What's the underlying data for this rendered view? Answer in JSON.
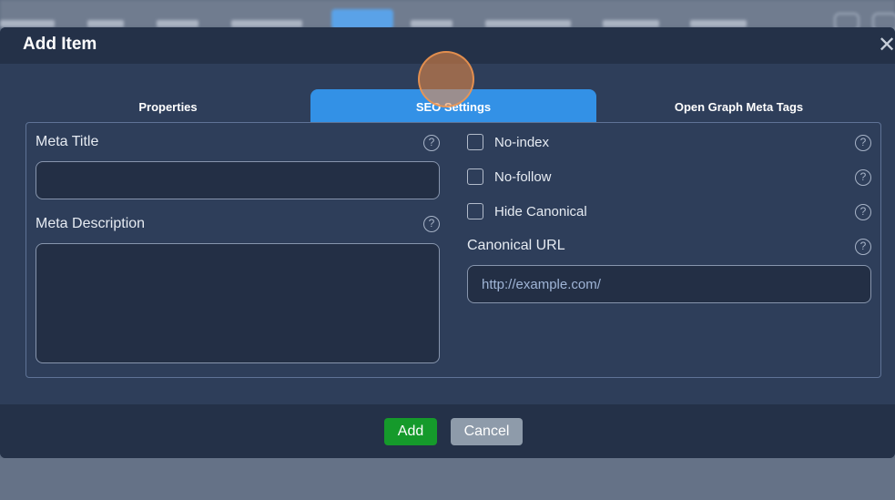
{
  "modal": {
    "title": "Add Item",
    "close_symbol": "✕"
  },
  "tabs": [
    {
      "label": "Properties",
      "active": false
    },
    {
      "label": "SEO Settings",
      "active": true
    },
    {
      "label": "Open Graph Meta Tags",
      "active": false
    }
  ],
  "seo": {
    "meta_title_label": "Meta Title",
    "meta_title_value": "",
    "meta_description_label": "Meta Description",
    "meta_description_value": "",
    "noindex_label": "No-index",
    "nofollow_label": "No-follow",
    "hide_canonical_label": "Hide Canonical",
    "canonical_url_label": "Canonical URL",
    "canonical_url_placeholder": "http://example.com/",
    "help_symbol": "?"
  },
  "footer": {
    "add_label": "Add",
    "cancel_label": "Cancel"
  },
  "colors": {
    "active_tab": "#3391e6",
    "add_button": "#159a2b",
    "cancel_button": "#8e9baa"
  },
  "icons": [
    "close-icon",
    "help-icon",
    "checkbox-icon"
  ]
}
